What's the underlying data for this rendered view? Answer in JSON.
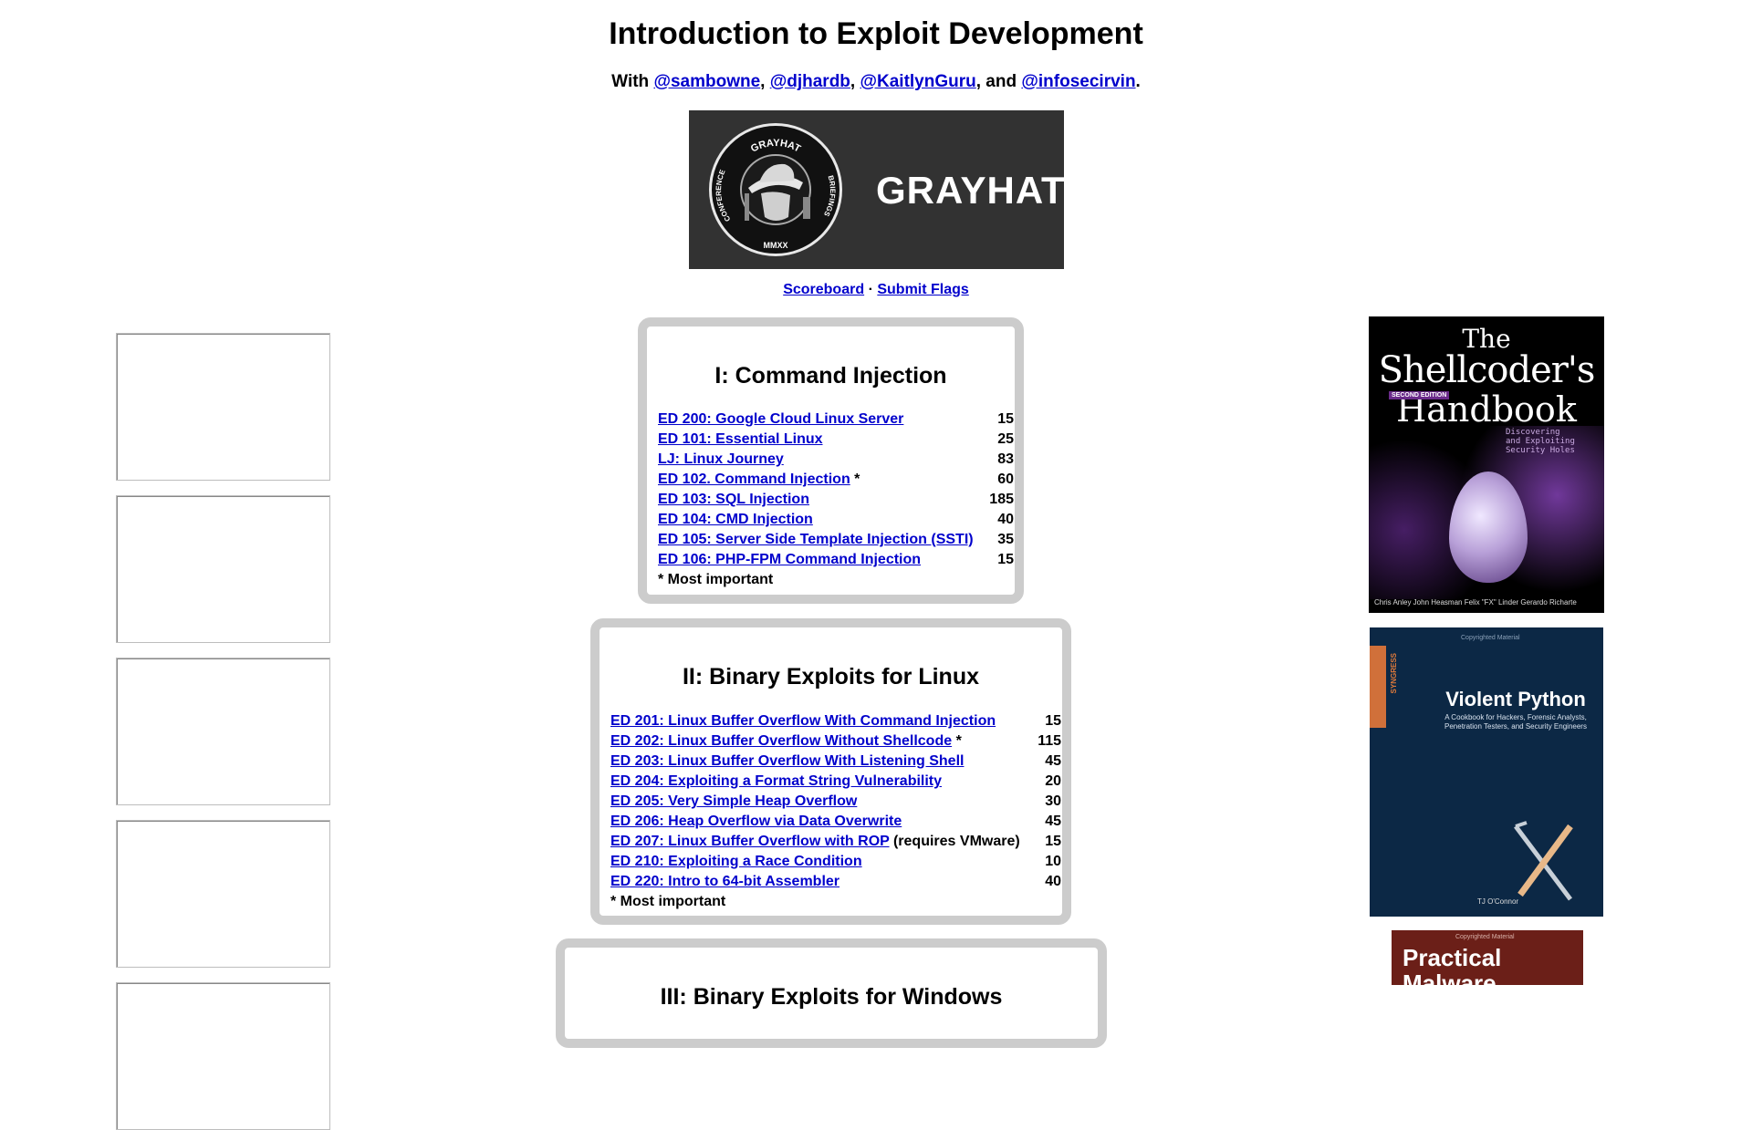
{
  "page": {
    "title": "Introduction to Exploit Development",
    "byline": {
      "prefix": "With",
      "people": [
        "@sambowne",
        "@djhardb",
        "@KaitlynGuru",
        "@infosecirvin"
      ],
      "sep1": ",",
      "sep2": ",",
      "sep3": ", and",
      "end": "."
    },
    "banner": {
      "word": "GRAYHAT",
      "seal_top": "GRAYHAT",
      "seal_left": "CONFERENCE",
      "seal_right": "BRIEFINGS",
      "seal_bottom": "MMXX"
    },
    "nav": {
      "scoreboard": "Scoreboard",
      "dot": "·",
      "submit": "Submit Flags"
    }
  },
  "sections": [
    {
      "title": "I: Command Injection",
      "rows": [
        {
          "link": "ED 200: Google Cloud Linux Server",
          "extra": "",
          "points": "15"
        },
        {
          "link": "ED 101: Essential Linux",
          "extra": "",
          "points": "25"
        },
        {
          "link": "LJ: Linux Journey",
          "extra": "",
          "points": "83"
        },
        {
          "link": "ED 102. Command Injection",
          "extra": " *",
          "points": "60"
        },
        {
          "link": "ED 103: SQL Injection",
          "extra": "",
          "points": "185"
        },
        {
          "link": "ED 104: CMD Injection",
          "extra": "",
          "points": "40"
        },
        {
          "link": "ED 105: Server Side Template Injection (SSTI)",
          "extra": "",
          "points": "35"
        },
        {
          "link": "ED 106: PHP-FPM Command Injection",
          "extra": "",
          "points": "15"
        }
      ],
      "note": "* Most important"
    },
    {
      "title": "II: Binary Exploits for Linux",
      "rows": [
        {
          "link": "ED 201: Linux Buffer Overflow With Command Injection",
          "extra": "",
          "points": "15"
        },
        {
          "link": "ED 202: Linux Buffer Overflow Without Shellcode",
          "extra": " *",
          "points": "115"
        },
        {
          "link": "ED 203: Linux Buffer Overflow With Listening Shell",
          "extra": "",
          "points": "45"
        },
        {
          "link": "ED 204: Exploiting a Format String Vulnerability",
          "extra": "",
          "points": "20"
        },
        {
          "link": "ED 205: Very Simple Heap Overflow",
          "extra": "",
          "points": "30"
        },
        {
          "link": "ED 206: Heap Overflow via Data Overwrite",
          "extra": "",
          "points": "45"
        },
        {
          "link": "ED 207: Linux Buffer Overflow with ROP",
          "extra": " (requires VMware)",
          "points": "15"
        },
        {
          "link": "ED 210: Exploiting a Race Condition",
          "extra": "",
          "points": "10"
        },
        {
          "link": "ED 220: Intro to 64-bit Assembler",
          "extra": "",
          "points": "40"
        }
      ],
      "note": "* Most important"
    },
    {
      "title": "III: Binary Exploits for Windows"
    }
  ],
  "books": [
    {
      "title_line1": "The",
      "title_line2": "Shellcoder's",
      "title_line3": "Handbook",
      "edition": "SECOND EDITION",
      "subtitle1": "Discovering",
      "subtitle2": "and Exploiting",
      "subtitle3": "Security Holes",
      "authors": "Chris Anley  John Heasman  Felix \"FX\" Linder  Gerardo Richarte"
    },
    {
      "top": "Copyrighted Material",
      "publisher": "SYNGRESS",
      "title": "Violent Python",
      "subtitle": "A Cookbook for Hackers, Forensic Analysts, Penetration Testers, and Security Engineers",
      "author": "TJ O'Connor"
    },
    {
      "top": "Copyrighted Material",
      "title_line1": "Practical",
      "title_line2": "Malware"
    }
  ],
  "colors": {
    "link": "#0000cc",
    "section_border": "#cccccc",
    "banner_bg": "#323232"
  }
}
